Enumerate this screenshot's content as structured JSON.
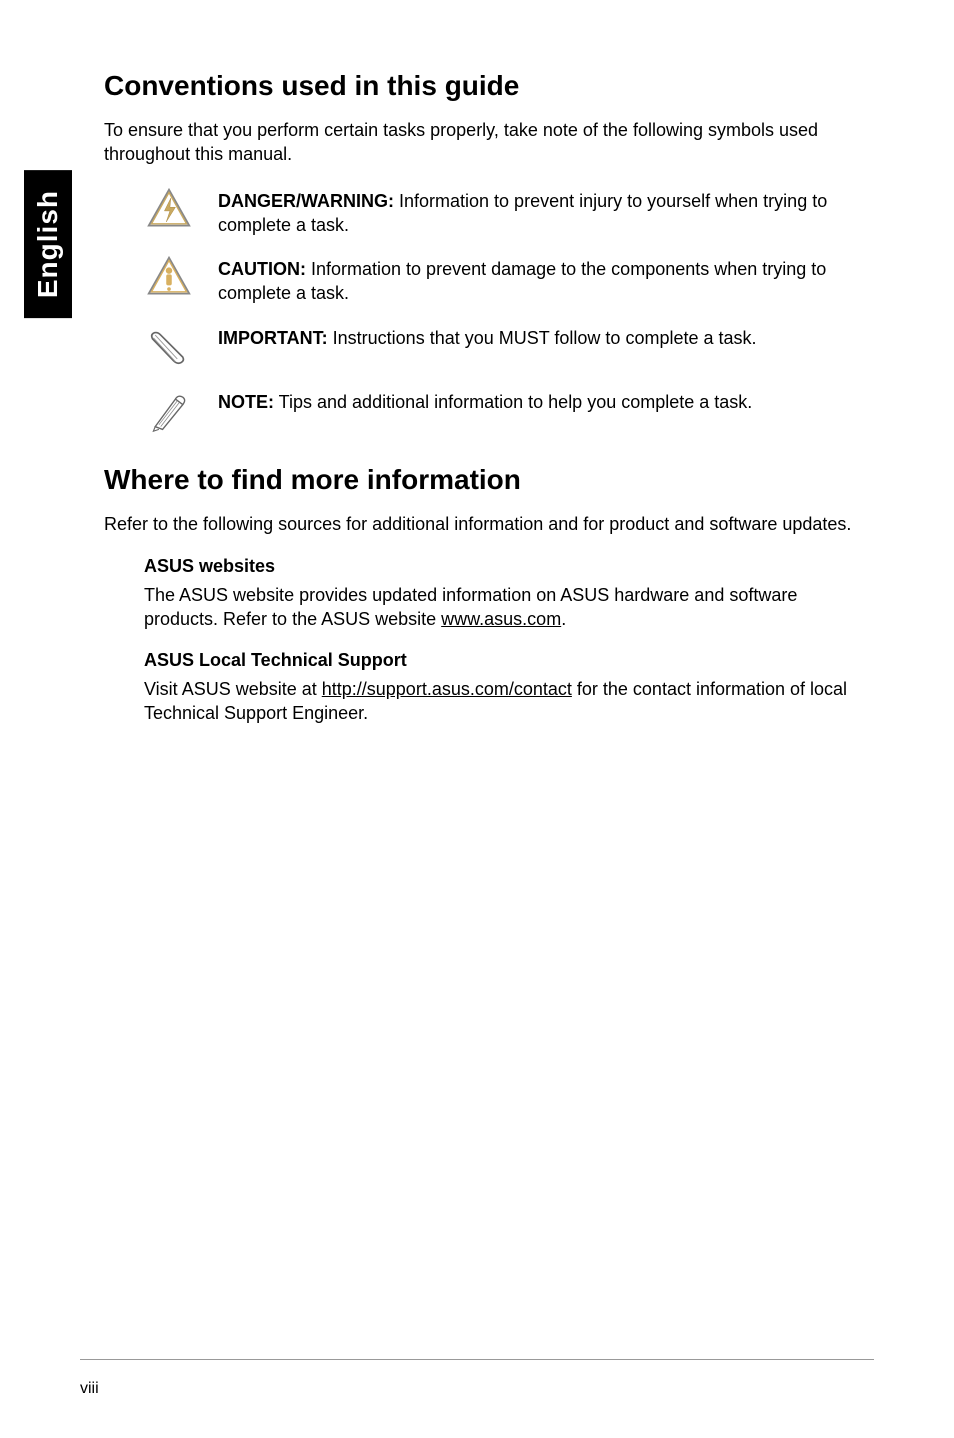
{
  "language_tab": "English",
  "section1": {
    "heading": "Conventions used in this guide",
    "intro": "To ensure that you perform certain tasks properly, take note of the following symbols used throughout this manual.",
    "items": [
      {
        "label": "DANGER/WARNING:",
        "text": " Information to prevent injury to yourself when trying to complete a task."
      },
      {
        "label": "CAUTION:",
        "text": " Information to prevent damage to the components when trying to complete a task."
      },
      {
        "label": "IMPORTANT:",
        "text": " Instructions that you MUST follow to complete a task."
      },
      {
        "label": "NOTE:",
        "text": " Tips and additional information to help you complete a task."
      }
    ]
  },
  "section2": {
    "heading": "Where to find more information",
    "intro": "Refer to the following sources for additional information and for product and software updates.",
    "sub1": {
      "heading": "ASUS websites",
      "text_pre": "The ASUS website provides updated information on ASUS hardware and software products. Refer to the ASUS website ",
      "link": "www.asus.com",
      "text_post": "."
    },
    "sub2": {
      "heading": "ASUS Local Technical Support",
      "text_pre": "Visit ASUS website at ",
      "link": "http://support.asus.com/contact",
      "text_post": " for the contact information of local Technical Support Engineer."
    }
  },
  "page_number": "viii"
}
